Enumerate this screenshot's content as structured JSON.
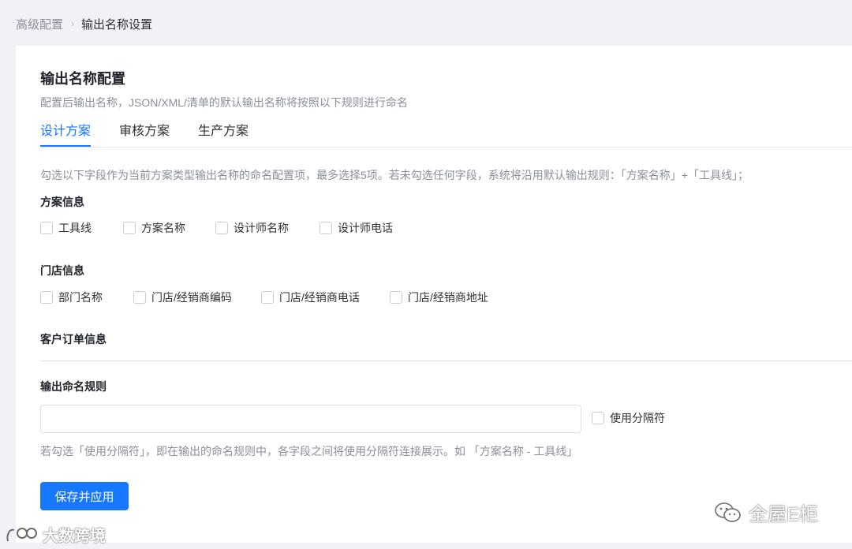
{
  "breadcrumb": {
    "parent": "高级配置",
    "separator": "›",
    "current": "输出名称设置"
  },
  "page": {
    "title": "输出名称配置",
    "subtitle": "配置后输出名称，JSON/XML/清单的默认输出名称将按照以下规则进行命名"
  },
  "tabs": [
    {
      "label": "设计方案",
      "active": true
    },
    {
      "label": "审核方案",
      "active": false
    },
    {
      "label": "生产方案",
      "active": false
    }
  ],
  "hint": "勾选以下字段作为当前方案类型输出名称的命名配置项，最多选择5项。若未勾选任何字段，系统将沿用默认输出规则：「方案名称」+「工具线」；",
  "sections": {
    "scheme_info": {
      "title": "方案信息",
      "fields": [
        "工具线",
        "方案名称",
        "设计师名称",
        "设计师电话"
      ]
    },
    "store_info": {
      "title": "门店信息",
      "fields": [
        "部门名称",
        "门店/经销商编码",
        "门店/经销商电话",
        "门店/经销商地址"
      ]
    },
    "order_info": {
      "title": "客户订单信息"
    }
  },
  "naming_rule": {
    "title": "输出命名规则",
    "input_value": "",
    "use_separator_label": "使用分隔符",
    "hint": "若勾选「使用分隔符」，即在输出的命名规则中，各字段之间将使用分隔符连接展示。如 「方案名称 - 工具线」"
  },
  "save_button": "保存并应用",
  "watermarks": {
    "right": "全屋E柜",
    "left": "大数跨境"
  },
  "colors": {
    "primary": "#1677ff",
    "background": "#f0f2f5",
    "muted_text": "#8a8f99"
  }
}
